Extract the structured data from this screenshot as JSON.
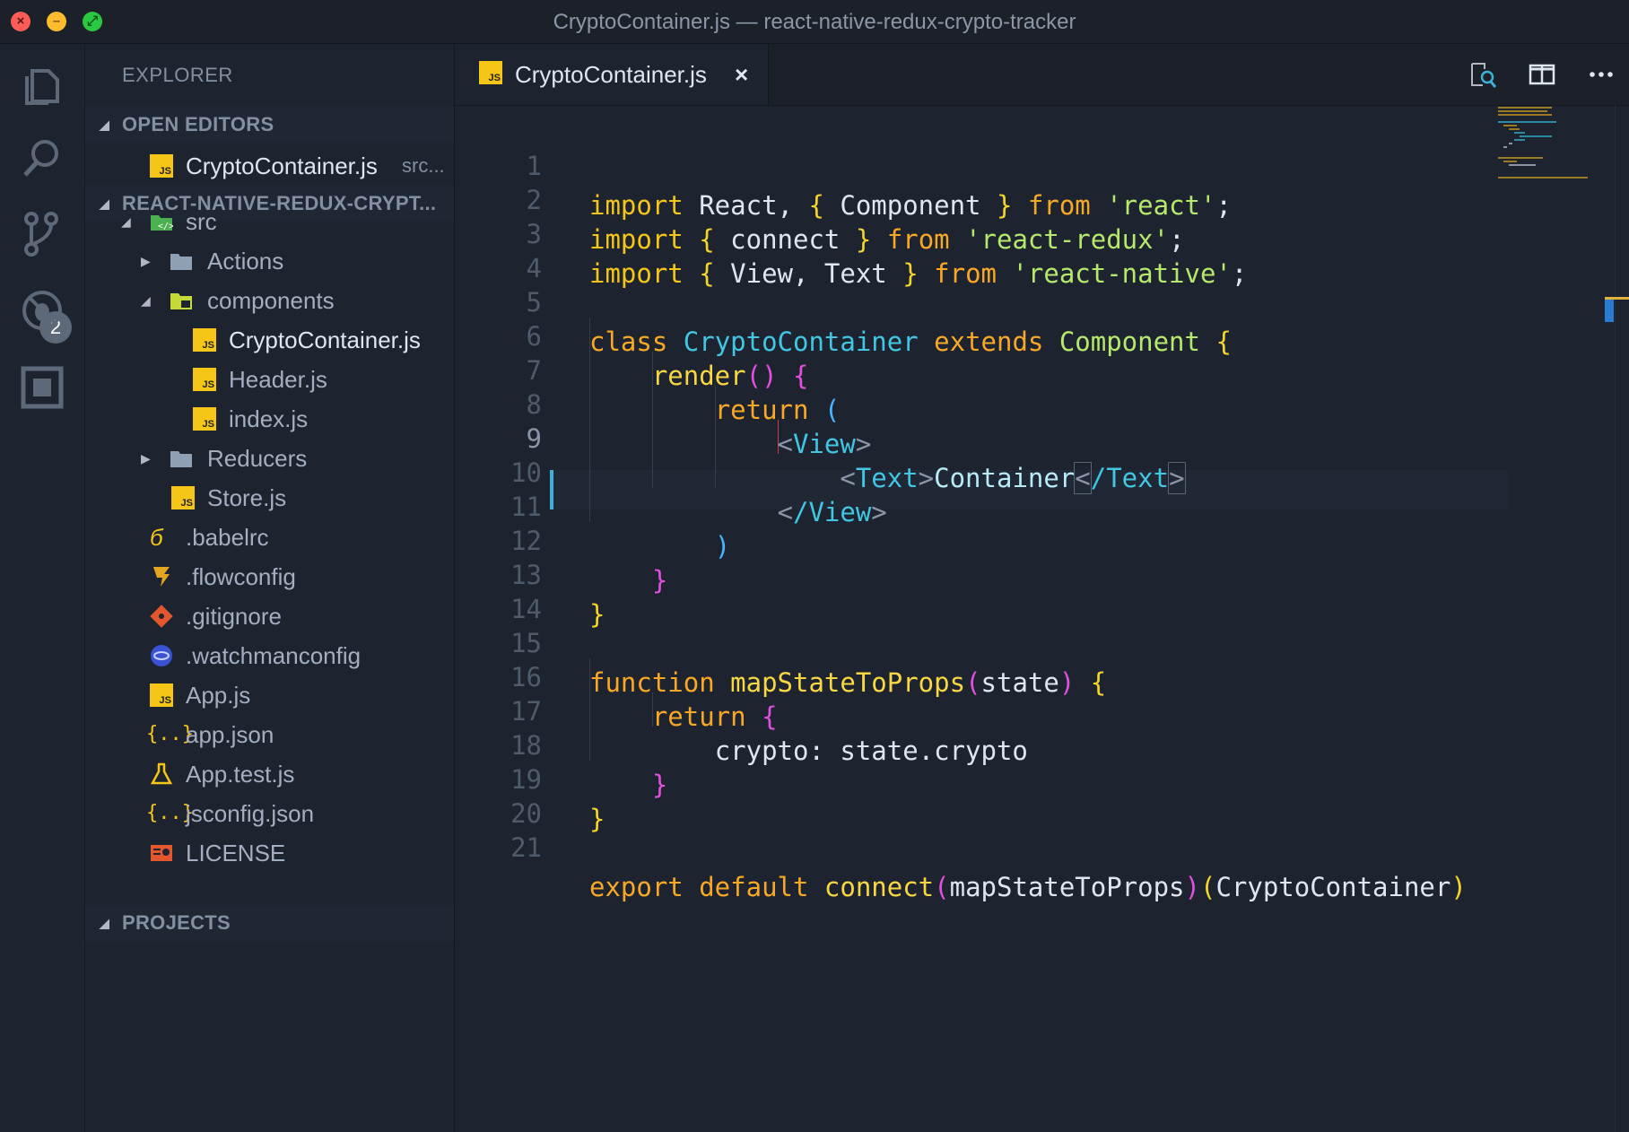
{
  "window": {
    "title": "CryptoContainer.js — react-native-redux-crypto-tracker"
  },
  "activity_bar": {
    "items": [
      {
        "icon": "files-icon"
      },
      {
        "icon": "search-icon"
      },
      {
        "icon": "source-control-icon",
        "badge": "2"
      },
      {
        "icon": "debug-icon"
      },
      {
        "icon": "extensions-icon"
      }
    ]
  },
  "sidebar": {
    "title": "EXPLORER",
    "open_editors": {
      "label": "OPEN EDITORS",
      "items": [
        {
          "name": "CryptoContainer.js",
          "path": "src..."
        }
      ]
    },
    "project": {
      "label": "REACT-NATIVE-REDUX-CRYPT..."
    },
    "tree": [
      {
        "name": "src",
        "type": "folder-open",
        "icon": "src-folder-icon"
      },
      {
        "name": "Actions",
        "type": "folder-closed",
        "icon": "folder-icon"
      },
      {
        "name": "components",
        "type": "folder-open",
        "icon": "components-folder-icon"
      },
      {
        "name": "CryptoContainer.js",
        "type": "file",
        "icon": "js-file-icon"
      },
      {
        "name": "Header.js",
        "type": "file",
        "icon": "js-file-icon"
      },
      {
        "name": "index.js",
        "type": "file",
        "icon": "js-file-icon"
      },
      {
        "name": "Reducers",
        "type": "folder-closed",
        "icon": "folder-icon"
      },
      {
        "name": "Store.js",
        "type": "file",
        "icon": "js-file-icon"
      },
      {
        "name": ".babelrc",
        "type": "file",
        "icon": "babel-icon"
      },
      {
        "name": ".flowconfig",
        "type": "file",
        "icon": "flow-icon"
      },
      {
        "name": ".gitignore",
        "type": "file",
        "icon": "git-icon"
      },
      {
        "name": ".watchmanconfig",
        "type": "file",
        "icon": "watchman-icon"
      },
      {
        "name": "App.js",
        "type": "file",
        "icon": "js-file-icon"
      },
      {
        "name": "app.json",
        "type": "file",
        "icon": "json-icon"
      },
      {
        "name": "App.test.js",
        "type": "file",
        "icon": "test-flask-icon"
      },
      {
        "name": "jsconfig.json",
        "type": "file",
        "icon": "json-icon"
      },
      {
        "name": "LICENSE",
        "type": "file",
        "icon": "license-icon"
      }
    ],
    "projects": {
      "label": "PROJECTS"
    }
  },
  "editor": {
    "tab": {
      "label": "CryptoContainer.js",
      "close": "×",
      "icon_text": "JS"
    },
    "toolbar": [
      {
        "icon": "open-preview-icon"
      },
      {
        "icon": "split-editor-icon"
      },
      {
        "icon": "more-actions-icon"
      }
    ],
    "cursor_line": 9,
    "lines": [
      {
        "n": "1",
        "text": "import React, { Component } from 'react';"
      },
      {
        "n": "2",
        "text": "import { connect } from 'react-redux';"
      },
      {
        "n": "3",
        "text": "import { View, Text } from 'react-native';"
      },
      {
        "n": "4",
        "text": ""
      },
      {
        "n": "5",
        "text": "class CryptoContainer extends Component {"
      },
      {
        "n": "6",
        "text": "    render() {"
      },
      {
        "n": "7",
        "text": "        return ("
      },
      {
        "n": "8",
        "text": "            <View>"
      },
      {
        "n": "9",
        "text": "                <Text>Container</Text>"
      },
      {
        "n": "10",
        "text": "            </View>"
      },
      {
        "n": "11",
        "text": "        )"
      },
      {
        "n": "12",
        "text": "    }"
      },
      {
        "n": "13",
        "text": "}"
      },
      {
        "n": "14",
        "text": ""
      },
      {
        "n": "15",
        "text": "function mapStateToProps(state) {"
      },
      {
        "n": "16",
        "text": "    return {"
      },
      {
        "n": "17",
        "text": "        crypto: state.crypto"
      },
      {
        "n": "18",
        "text": "    }"
      },
      {
        "n": "19",
        "text": "}"
      },
      {
        "n": "20",
        "text": ""
      },
      {
        "n": "21",
        "text": "export default connect(mapStateToProps)(CryptoContainer)"
      }
    ]
  },
  "colors": {
    "background": "#1d2430",
    "keyword": "#f9a825",
    "class_name": "#41c6e3",
    "string": "#b6e86b",
    "bracket_magenta": "#e24fe0",
    "bracket_blue": "#49b4ff",
    "cursor_line_marker": "#3fb0d6",
    "js_icon": "#f5c518"
  }
}
